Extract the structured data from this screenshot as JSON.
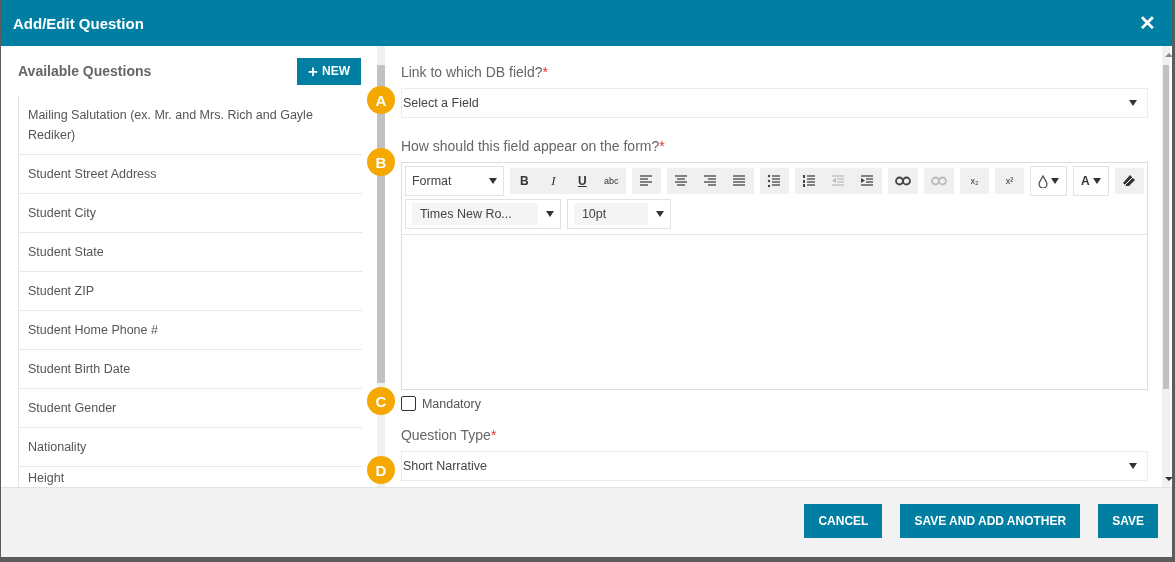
{
  "dialog": {
    "title": "Add/Edit Question",
    "close": "✕"
  },
  "available": {
    "title": "Available Questions",
    "new_button": "NEW",
    "new_icon": "+",
    "items": [
      "Mailing Salutation (ex. Mr. and Mrs. Rich and Gayle Rediker)",
      "Student Street Address",
      "Student City",
      "Student State",
      "Student ZIP",
      "Student Home Phone #",
      "Student Birth Date",
      "Student Gender",
      "Nationality",
      "Height"
    ]
  },
  "db_field": {
    "label": "Link to which DB field?",
    "required": "*",
    "badge": "A",
    "value": "Select a Field"
  },
  "appearance": {
    "label": "How should this field appear on the form?",
    "required": "*",
    "badge": "B",
    "format": "Format",
    "font": "Times New Ro...",
    "size": "10pt",
    "groups": [
      [
        {
          "kind": "bold",
          "label": "B",
          "disabled": false
        },
        {
          "kind": "italic",
          "label": "I",
          "disabled": false
        },
        {
          "kind": "underline",
          "label": "U",
          "disabled": false
        },
        {
          "kind": "small",
          "label": "abc",
          "disabled": false
        }
      ],
      [
        {
          "kind": "alignleft",
          "disabled": false
        }
      ],
      [
        {
          "kind": "aligncenter",
          "disabled": false
        },
        {
          "kind": "alignright",
          "disabled": false
        },
        {
          "kind": "justify",
          "disabled": false
        }
      ],
      [
        {
          "kind": "bullets",
          "disabled": false
        }
      ],
      [
        {
          "kind": "numbers",
          "disabled": false
        },
        {
          "kind": "outdent",
          "disabled": true
        },
        {
          "kind": "indent",
          "disabled": false
        }
      ],
      [
        {
          "kind": "link",
          "disabled": false
        }
      ],
      [
        {
          "kind": "unlink",
          "disabled": true
        }
      ],
      [
        {
          "kind": "sub",
          "label": "x₂",
          "disabled": false
        }
      ],
      [
        {
          "kind": "sup",
          "label": "x²",
          "disabled": false
        }
      ],
      [
        {
          "kind": "droplet",
          "disabled": false
        }
      ],
      [
        {
          "kind": "letter",
          "label": "A",
          "disabled": false
        }
      ],
      [
        {
          "kind": "clear",
          "disabled": false
        }
      ]
    ]
  },
  "mandatory": {
    "label": "Mandatory",
    "checked": false,
    "badge": "C"
  },
  "question_type": {
    "label": "Question Type",
    "required": "*",
    "badge": "D",
    "value": "Short Narrative"
  },
  "buttons": [
    "CANCEL",
    "SAVE AND ADD ANOTHER",
    "SAVE"
  ]
}
